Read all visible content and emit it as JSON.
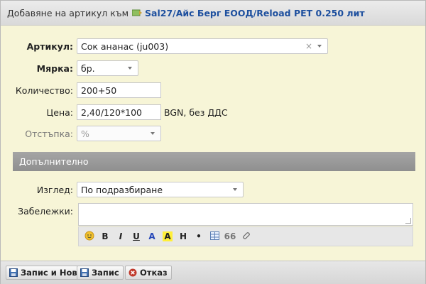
{
  "title": {
    "prefix": "Добавяне на артикул към",
    "doc_link": "Sal27/Айс Берг ЕООД/Reload PET 0.250 лит"
  },
  "fields": {
    "article": {
      "label": "Артикул:",
      "value": "Сок ананас (ju003)"
    },
    "measure": {
      "label": "Мярка:",
      "value": "бр."
    },
    "quantity": {
      "label": "Количество:",
      "value": "200+50"
    },
    "price": {
      "label": "Цена:",
      "value": "2,40/120*100",
      "suffix": "BGN, без ДДС"
    },
    "discount": {
      "label": "Отстъпка:",
      "value": "%"
    }
  },
  "section": {
    "title": "Допълнително"
  },
  "extra": {
    "view": {
      "label": "Изглед:",
      "value": "По подразбиране"
    },
    "notes": {
      "label": "Забележки:",
      "value": ""
    }
  },
  "toolbar": {
    "bold": "B",
    "italic": "I",
    "underline": "U",
    "color": "A",
    "highlight": "A",
    "heading": "H",
    "bullet": "•",
    "quote": "66"
  },
  "buttons": {
    "save_new": "Запис и Нов",
    "save": "Запис",
    "cancel": "Отказ"
  },
  "colors": {
    "background": "#f7f5d7",
    "link": "#1d4f9e",
    "section_header": "#9a9a9a",
    "cancel_icon": "#c0392b",
    "save_icon": "#3f6fb0"
  }
}
